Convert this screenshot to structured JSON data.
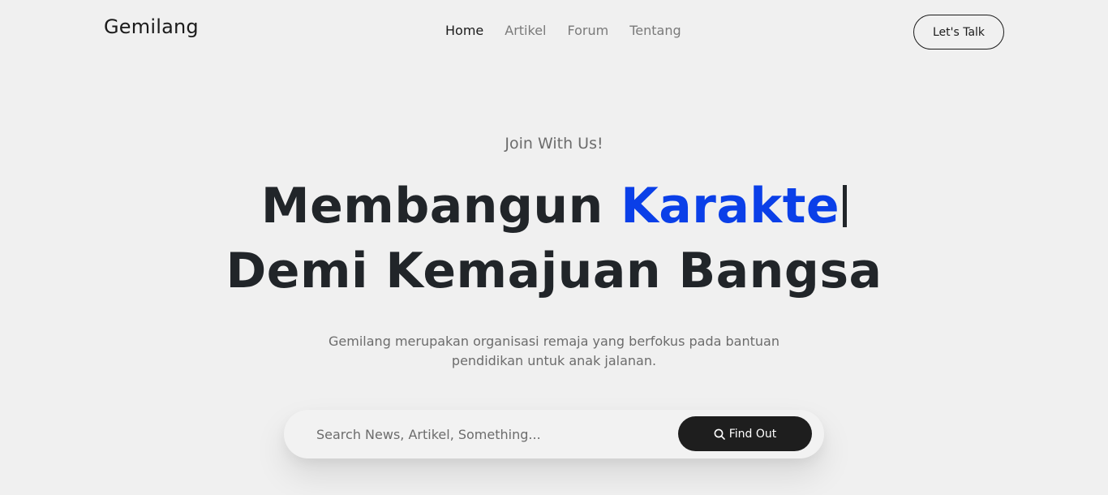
{
  "navbar": {
    "brand": "Gemilang",
    "links": [
      {
        "label": "Home",
        "active": true
      },
      {
        "label": "Artikel",
        "active": false
      },
      {
        "label": "Forum",
        "active": false
      },
      {
        "label": "Tentang",
        "active": false
      }
    ],
    "cta_label": "Let's Talk"
  },
  "hero": {
    "kicker": "Join With Us!",
    "title_line1_prefix": "Membangun",
    "title_line1_accent": "Karakte",
    "title_line2": "Demi Kemajuan Bangsa",
    "description": "Gemilang merupakan organisasi remaja yang berfokus pada bantuan pendidikan untuk anak jalanan."
  },
  "search": {
    "placeholder": "Search News, Artikel, Something...",
    "value": "",
    "button_label": "Find Out",
    "button_icon": "search-icon"
  },
  "colors": {
    "background": "#f0f0f0",
    "accent": "#0a3fe8",
    "dark": "#1e1e1e",
    "text_muted": "#6c6c6c"
  }
}
